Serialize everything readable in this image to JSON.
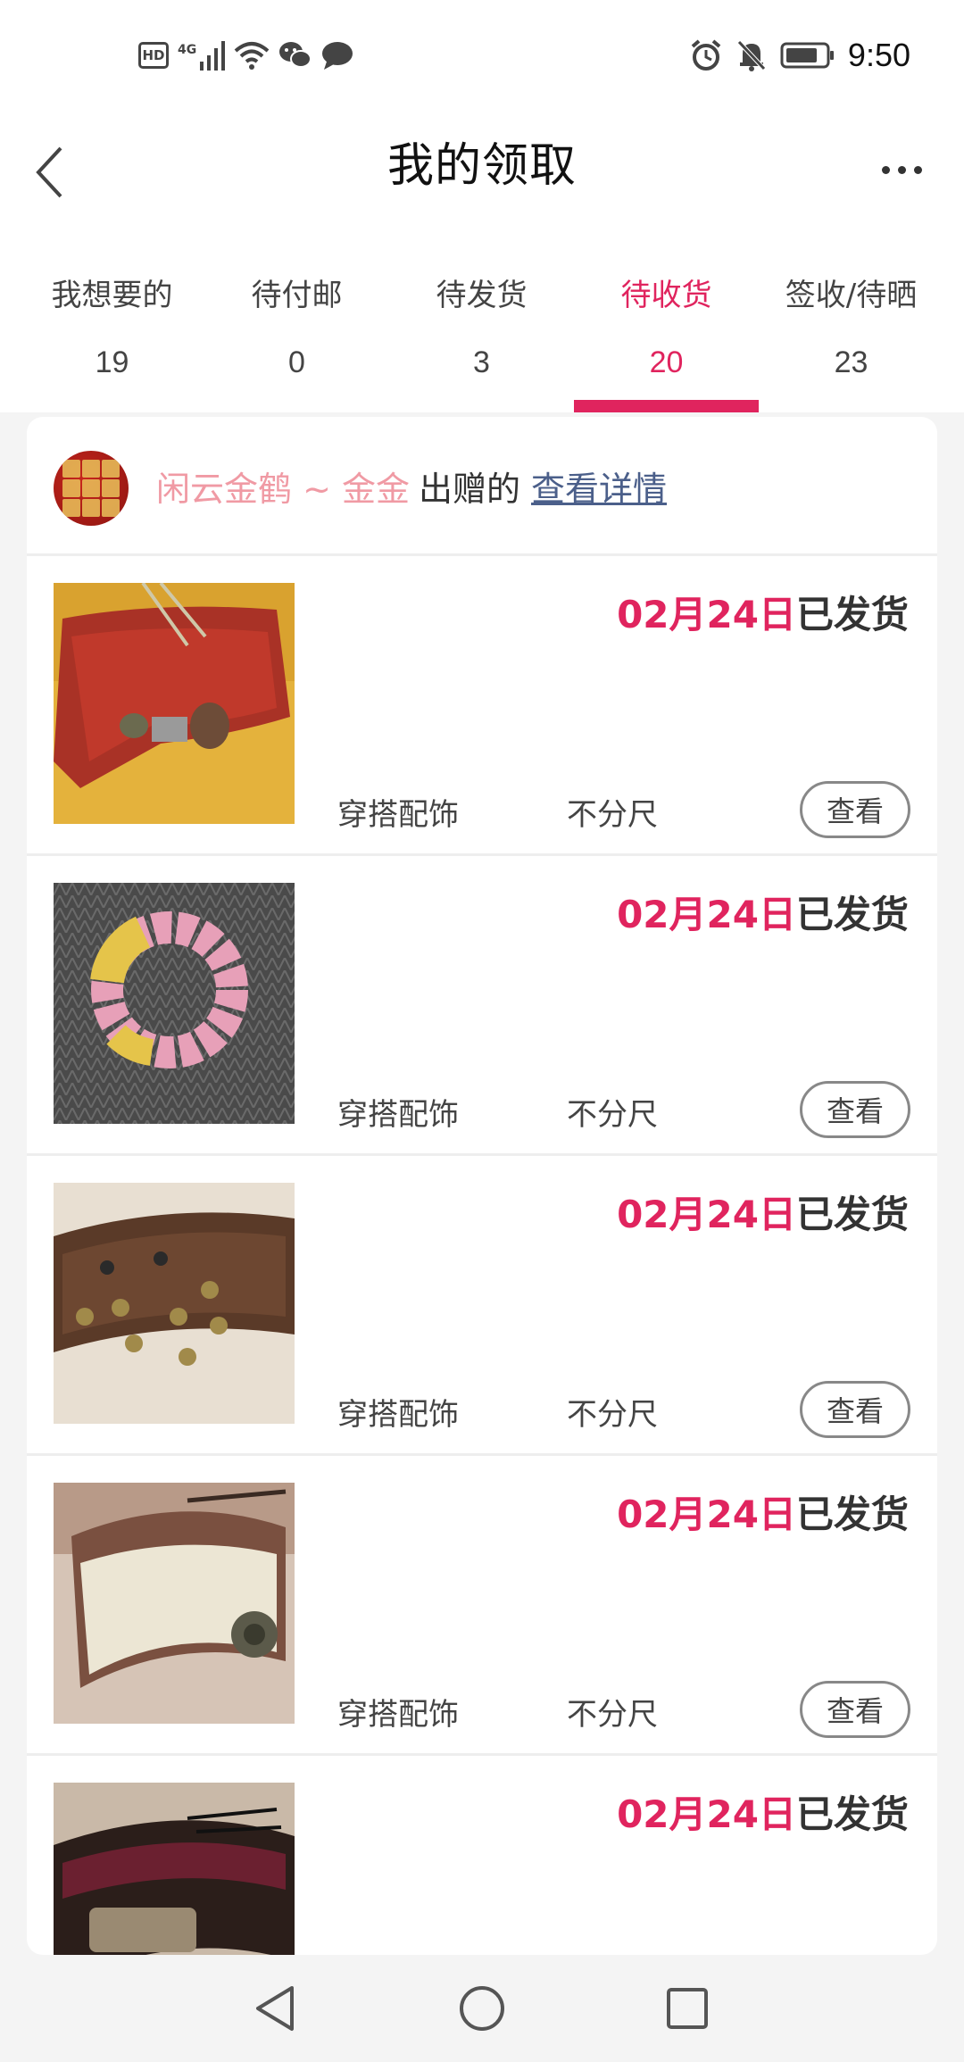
{
  "status_bar": {
    "hd": "HD",
    "network": "4G",
    "time": "9:50"
  },
  "header": {
    "title": "我的领取"
  },
  "tabs": [
    {
      "label": "我想要的",
      "count": "19",
      "active": false
    },
    {
      "label": "待付邮",
      "count": "0",
      "active": false
    },
    {
      "label": "待发货",
      "count": "3",
      "active": false
    },
    {
      "label": "待收货",
      "count": "20",
      "active": true
    },
    {
      "label": "签收/待晒",
      "count": "23",
      "active": false
    }
  ],
  "sender": {
    "name": "闲云金鹤 ~ 金金",
    "action": "出赠的",
    "link": "查看详情"
  },
  "items": [
    {
      "date": "02月24日",
      "status": "已发货",
      "category": "穿搭配饰",
      "size": "不分尺",
      "button": "查看"
    },
    {
      "date": "02月24日",
      "status": "已发货",
      "category": "穿搭配饰",
      "size": "不分尺",
      "button": "查看"
    },
    {
      "date": "02月24日",
      "status": "已发货",
      "category": "穿搭配饰",
      "size": "不分尺",
      "button": "查看"
    },
    {
      "date": "02月24日",
      "status": "已发货",
      "category": "穿搭配饰",
      "size": "不分尺",
      "button": "查看"
    },
    {
      "date": "02月24日",
      "status": "已发货",
      "category": "",
      "size": "",
      "button": ""
    }
  ],
  "colors": {
    "accent": "#e0245e",
    "sender_name": "#f09aa4",
    "link": "#4b5f8a"
  }
}
